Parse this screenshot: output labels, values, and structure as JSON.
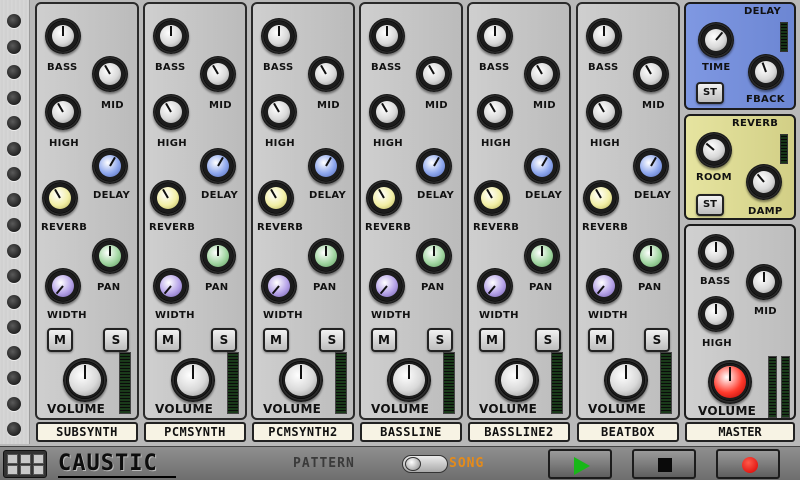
{
  "labels": {
    "bass": "BASS",
    "mid": "MID",
    "high": "HIGH",
    "delay": "DELAY",
    "reverb": "REVERB",
    "pan": "PAN",
    "width": "WIDTH",
    "mute": "M",
    "solo": "S",
    "volume": "VOLUME"
  },
  "channels": [
    {
      "name": "SUBSYNTH"
    },
    {
      "name": "PCMSYNTH"
    },
    {
      "name": "PCMSYNTH2"
    },
    {
      "name": "BASSLINE"
    },
    {
      "name": "BASSLINE2"
    },
    {
      "name": "BEATBOX"
    }
  ],
  "effects": {
    "delay": {
      "title": "DELAY",
      "time_label": "TIME",
      "feedback_label": "FBACK",
      "stereo_label": "ST"
    },
    "reverb": {
      "title": "REVERB",
      "room_label": "ROOM",
      "damp_label": "DAMP",
      "stereo_label": "ST"
    },
    "master": {
      "bass_label": "BASS",
      "mid_label": "MID",
      "high_label": "HIGH",
      "volume_label": "VOLUME",
      "name": "MASTER"
    }
  },
  "bottom_bar": {
    "logo": "CAUSTIC",
    "mode_pattern": "PATTERN",
    "mode_song": "SONG"
  },
  "colors": {
    "delay_panel": "#7f98e2",
    "reverb_panel": "#e6e4a0",
    "song_active": "#e58b1a",
    "play": "#18b818",
    "record": "#d80000"
  },
  "icons": {
    "menu": "grid-menu-icon",
    "play": "play-icon",
    "stop": "stop-icon",
    "record": "record-icon"
  }
}
